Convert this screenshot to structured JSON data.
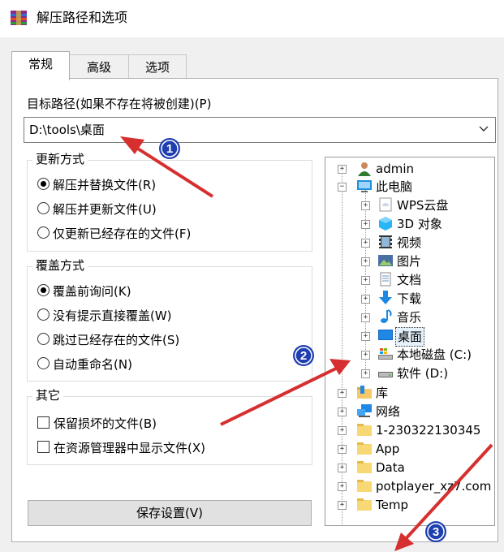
{
  "window": {
    "title": "解压路径和选项",
    "icon": "winrar-icon"
  },
  "tabs": [
    {
      "label": "常规",
      "active": true
    },
    {
      "label": "高级",
      "active": false
    },
    {
      "label": "选项",
      "active": false
    }
  ],
  "general": {
    "dest_label": "目标路径(如果不存在将被创建)(P)",
    "dest_value": "D:\\tools\\桌面",
    "update_group": {
      "title": "更新方式",
      "options": [
        {
          "label": "解压并替换文件(R)",
          "checked": true
        },
        {
          "label": "解压并更新文件(U)",
          "checked": false
        },
        {
          "label": "仅更新已经存在的文件(F)",
          "checked": false
        }
      ]
    },
    "overwrite_group": {
      "title": "覆盖方式",
      "options": [
        {
          "label": "覆盖前询问(K)",
          "checked": true
        },
        {
          "label": "没有提示直接覆盖(W)",
          "checked": false
        },
        {
          "label": "跳过已经存在的文件(S)",
          "checked": false
        },
        {
          "label": "自动重命名(N)",
          "checked": false
        }
      ]
    },
    "other_group": {
      "title": "其它",
      "options": [
        {
          "label": "保留损坏的文件(B)",
          "checked": false
        },
        {
          "label": "在资源管理器中显示文件(X)",
          "checked": false
        }
      ]
    },
    "save_button": "保存设置(V)"
  },
  "tree": {
    "items": [
      {
        "label": "admin",
        "icon": "user-icon"
      },
      {
        "label": "此电脑",
        "icon": "computer-icon"
      },
      {
        "label": "WPS云盘",
        "icon": "cloud-drive-icon"
      },
      {
        "label": "3D 对象",
        "icon": "3d-objects-icon"
      },
      {
        "label": "视频",
        "icon": "video-icon"
      },
      {
        "label": "图片",
        "icon": "pictures-icon"
      },
      {
        "label": "文档",
        "icon": "documents-icon"
      },
      {
        "label": "下载",
        "icon": "download-icon"
      },
      {
        "label": "音乐",
        "icon": "music-icon"
      },
      {
        "label": "桌面",
        "icon": "desktop-icon",
        "selected": true
      },
      {
        "label": "本地磁盘 (C:)",
        "icon": "system-drive-icon"
      },
      {
        "label": "软件 (D:)",
        "icon": "drive-icon"
      },
      {
        "label": "库",
        "icon": "library-icon"
      },
      {
        "label": "网络",
        "icon": "network-icon"
      },
      {
        "label": "1-230322130345",
        "icon": "folder-icon"
      },
      {
        "label": "App",
        "icon": "folder-icon"
      },
      {
        "label": "Data",
        "icon": "folder-icon"
      },
      {
        "label": "potplayer_xz7.com",
        "icon": "folder-icon"
      },
      {
        "label": "Temp",
        "icon": "folder-icon"
      }
    ]
  },
  "annotations": {
    "markers": [
      "1",
      "2",
      "3"
    ],
    "color": "#d62f2f",
    "marker_color": "#1f3fb0"
  }
}
